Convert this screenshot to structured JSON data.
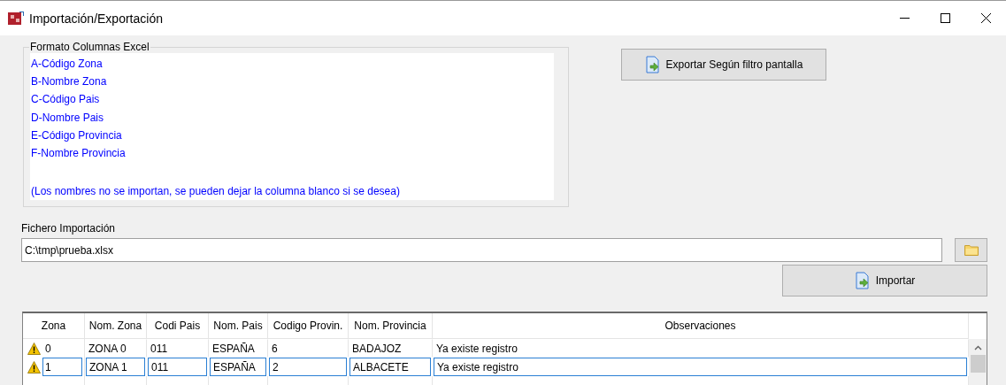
{
  "window": {
    "title": "Importación/Exportación"
  },
  "format_group": {
    "title": "Formato Columnas Excel",
    "lines": [
      "A-Código Zona",
      "B-Nombre Zona",
      "C-Código Pais",
      "D-Nombre Pais",
      "E-Código Provincia",
      "F-Nombre Provincia"
    ],
    "note": "(Los nombres no se importan, se pueden dejar la columna blanco si se desea)"
  },
  "export_button": {
    "label": "Exportar Según filtro pantalla"
  },
  "import_file": {
    "label": "Fichero Importación",
    "value": "C:\\tmp\\prueba.xlsx"
  },
  "import_button": {
    "label": "Importar"
  },
  "table": {
    "columns": [
      "Zona",
      "Nom. Zona",
      "Codi Pais",
      "Nom. Pais",
      "Codigo Provin.",
      "Nom. Provincia",
      "Observaciones"
    ],
    "rows": [
      {
        "warning": true,
        "selected": false,
        "cells": [
          "0",
          "ZONA 0",
          "011",
          "ESPAÑA",
          "6",
          "BADAJOZ",
          "Ya existe registro"
        ]
      },
      {
        "warning": true,
        "selected": true,
        "cells": [
          "1",
          "ZONA 1",
          "011",
          "ESPAÑA",
          "2",
          "ALBACETE",
          "Ya existe registro"
        ]
      }
    ]
  }
}
